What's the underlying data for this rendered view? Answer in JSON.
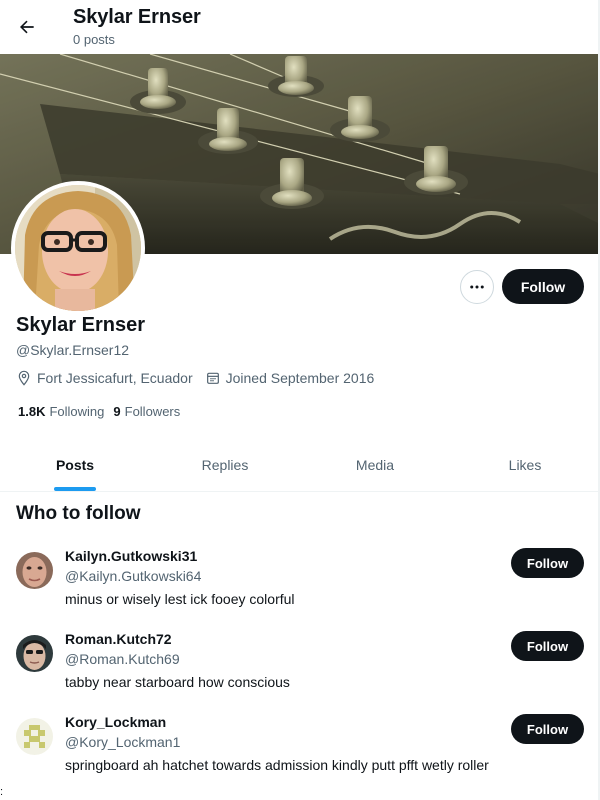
{
  "header": {
    "title": "Skylar Ernser",
    "posts_count": "0 posts"
  },
  "profile": {
    "name": "Skylar Ernser",
    "handle": "@Skylar.Ernser12",
    "location": "Fort Jessicafurt, Ecuador",
    "joined": "Joined September 2016",
    "following_count": "1.8K",
    "following_label": "Following",
    "followers_count": "9",
    "followers_label": "Followers",
    "follow_label": "Follow",
    "more_label": "···"
  },
  "tabs": [
    {
      "label": "Posts",
      "active": true
    },
    {
      "label": "Replies",
      "active": false
    },
    {
      "label": "Media",
      "active": false
    },
    {
      "label": "Likes",
      "active": false
    }
  ],
  "who_to_follow": {
    "title": "Who to follow",
    "follow_label": "Follow",
    "users": [
      {
        "name": "Kailyn.Gutkowski31",
        "handle": "@Kailyn.Gutkowski64",
        "bio": "minus or wisely lest ick fooey colorful"
      },
      {
        "name": "Roman.Kutch72",
        "handle": "@Roman.Kutch69",
        "bio": "tabby near starboard how conscious"
      },
      {
        "name": "Kory_Lockman",
        "handle": "@Kory_Lockman1",
        "bio": "springboard ah hatchet towards admission kindly putt pfft wetly roller"
      }
    ]
  },
  "stray_mark": ":",
  "colors": {
    "accent": "#1d9bf0",
    "primary_button": "#0f1419",
    "secondary_text": "#536471"
  },
  "icons": {
    "back": "arrow-left-icon",
    "more": "more-dots-icon",
    "location": "location-pin-icon",
    "calendar": "calendar-icon"
  }
}
